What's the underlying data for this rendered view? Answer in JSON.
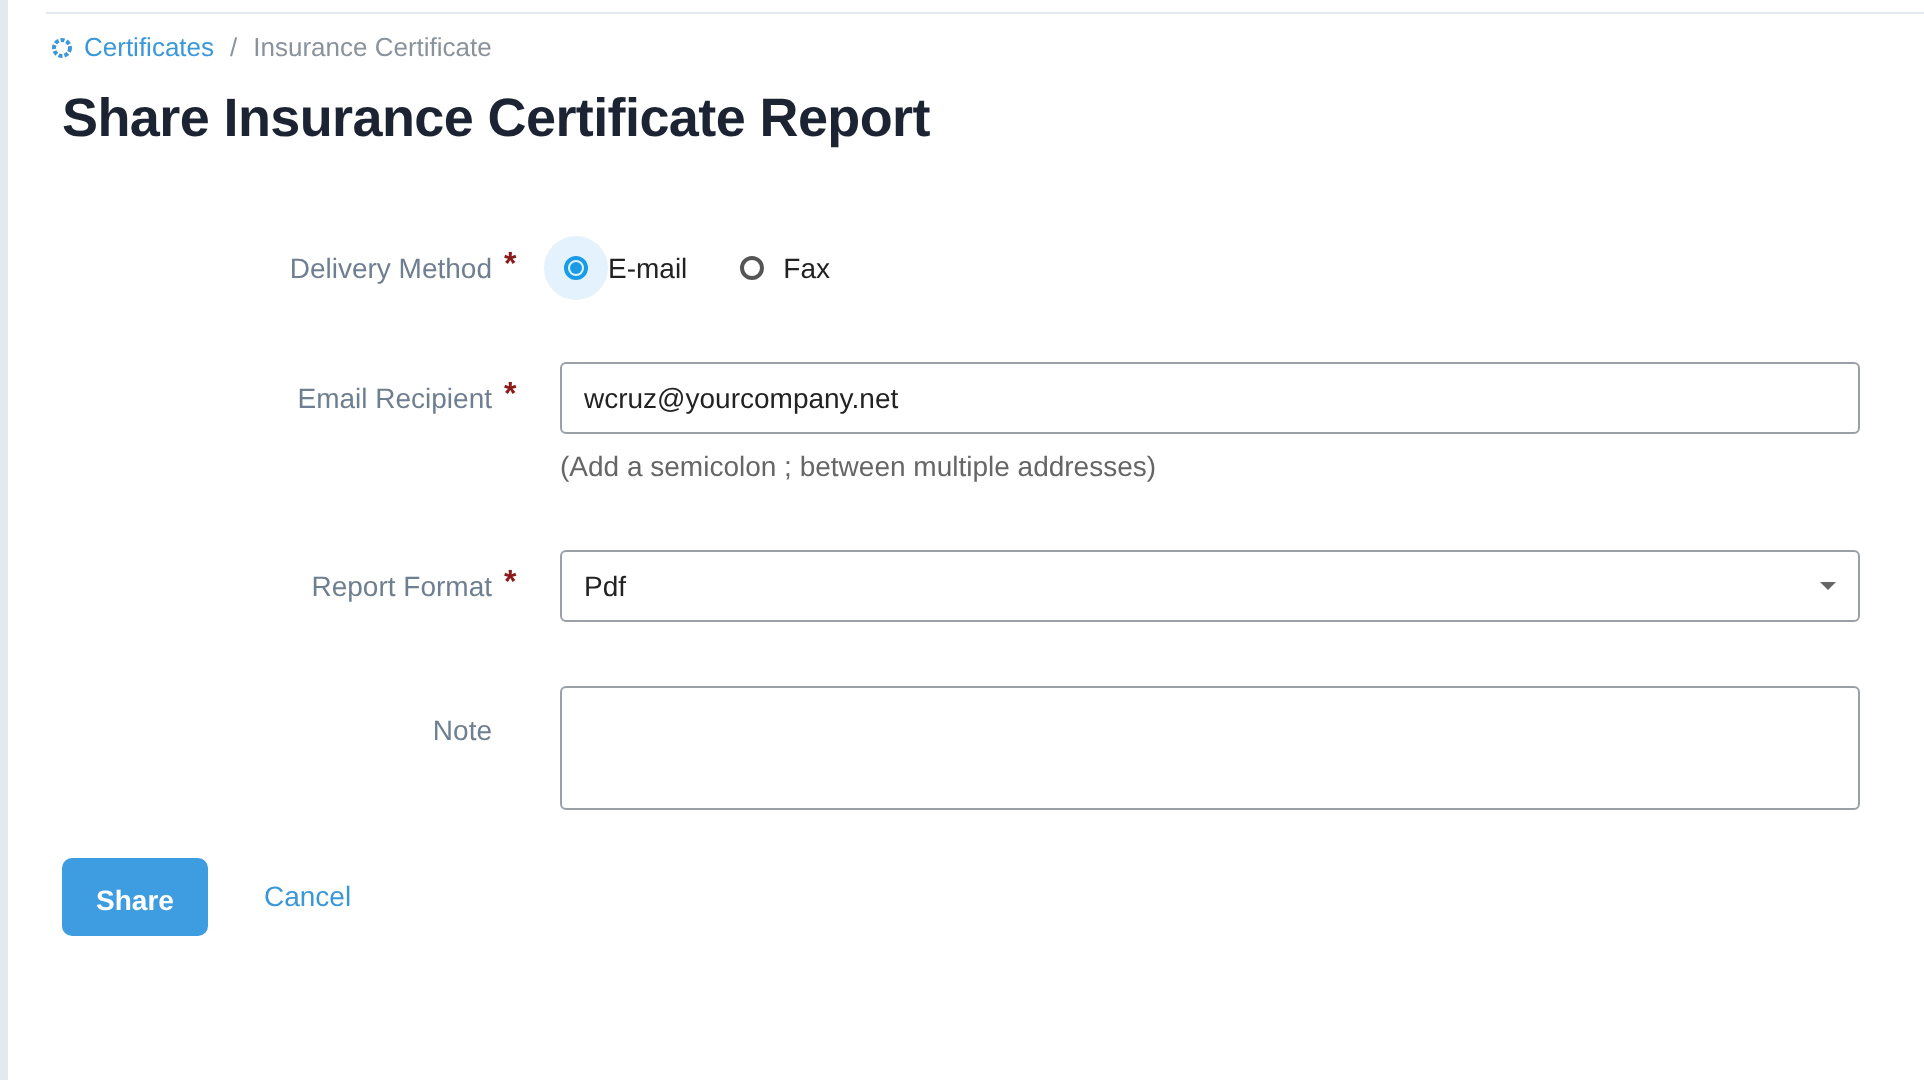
{
  "breadcrumb": [
    {
      "label": "Certificates",
      "link": true
    },
    {
      "label": "/",
      "link": false
    },
    {
      "label": "Insurance Certificate",
      "link": false
    }
  ],
  "title": "Share Insurance Certificate Report",
  "fields": [
    {
      "kind": "radio",
      "label": "Delivery Method",
      "required_mark": "*",
      "options": [
        {
          "label": "E-mail",
          "selected": true
        },
        {
          "label": "Fax",
          "selected": false
        }
      ]
    },
    {
      "kind": "text",
      "label": "Email Recipient",
      "required_mark": "*",
      "value": "wcruz@yourcompany.net",
      "hint": "(Add a semicolon ; between multiple addresses)"
    },
    {
      "kind": "select",
      "label": "Report Format",
      "required_mark": "*",
      "value": "Pdf"
    },
    {
      "kind": "textarea",
      "label": "Note"
    }
  ],
  "buttons": [
    {
      "kind": "primary",
      "label": "Share"
    },
    {
      "kind": "link",
      "label": "Cancel"
    }
  ]
}
